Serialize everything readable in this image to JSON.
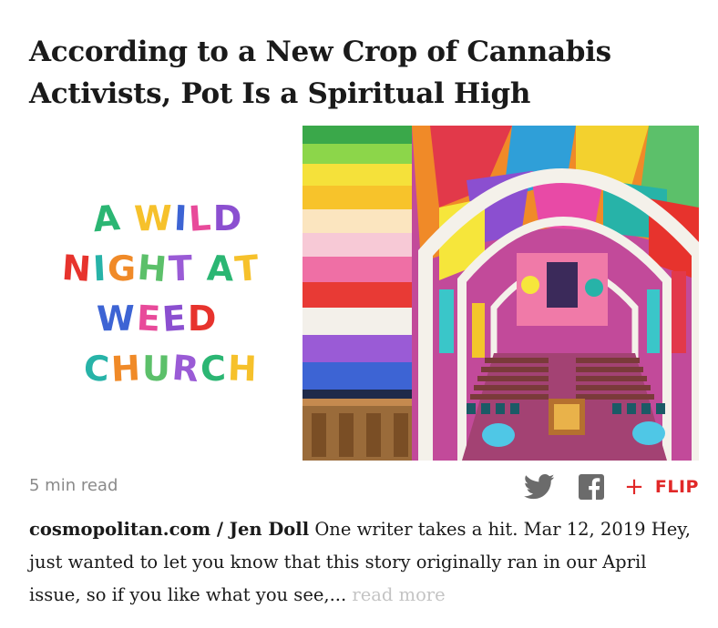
{
  "article": {
    "headline": "According to a New Crop of Cannabis Activists, Pot Is a Spiritual High",
    "read_time": "5 min read",
    "source": "cosmopolitan.com / Jen Doll",
    "excerpt": "One writer takes a hit. Mar 12, 2019 Hey, just wanted to let you know that this story originally ran in our April issue, so if you like what you see,...",
    "read_more": "read more"
  },
  "hero": {
    "wordart_lines": [
      "A WILD",
      "NIGHT AT",
      "WEED",
      "CHURCH"
    ]
  },
  "actions": {
    "twitter_icon": "twitter-icon",
    "facebook_icon": "facebook-icon",
    "flip_plus": "+",
    "flip_label": "FLIP"
  },
  "colors": {
    "flip_red": "#e12828",
    "meta_gray": "#8a8a8a",
    "read_more_gray": "#c4c4c4",
    "share_icon_gray": "#6b6b6b"
  }
}
